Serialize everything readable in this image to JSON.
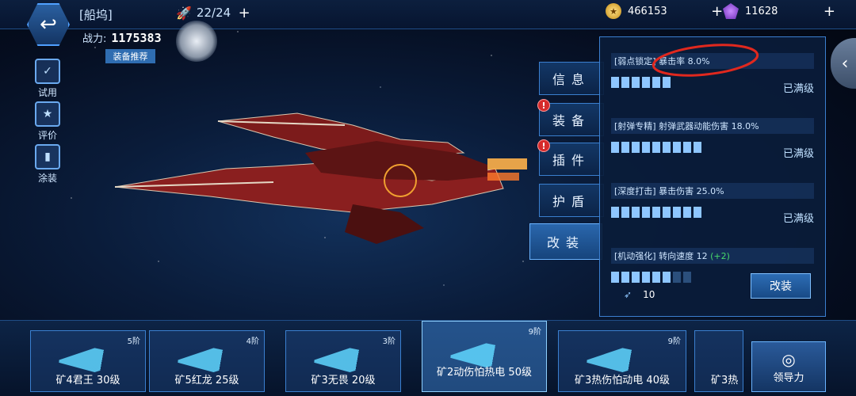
{
  "top": {
    "title": "[船坞]",
    "dock_count": "22/24",
    "power_label": "战力:",
    "power_value": "1175383",
    "recommend_btn": "装备推荐",
    "coins": "466153",
    "gems": "11628",
    "plus": "+"
  },
  "sidebar": [
    {
      "label": "试用",
      "icon": "✓"
    },
    {
      "label": "评价",
      "icon": "★"
    },
    {
      "label": "涂装",
      "icon": "▮"
    }
  ],
  "tabs": [
    {
      "label": "信息",
      "alert": false,
      "active": false
    },
    {
      "label": "装备",
      "alert": true,
      "active": false
    },
    {
      "label": "插件",
      "alert": true,
      "active": false
    },
    {
      "label": "护盾",
      "alert": false,
      "active": false
    },
    {
      "label": "改装",
      "alert": false,
      "active": true
    }
  ],
  "mods": [
    {
      "head": "[弱点锁定] 暴击率 8.0%",
      "filled": 6,
      "total": 6,
      "status": "已满级"
    },
    {
      "head": "[射弹专精] 射弹武器动能伤害 18.0%",
      "filled": 9,
      "total": 9,
      "status": "已满级"
    },
    {
      "head": "[深度打击] 暴击伤害 25.0%",
      "filled": 9,
      "total": 9,
      "status": "已满级"
    },
    {
      "head": "[机动强化] 转向速度 12",
      "bonus": "(+2)",
      "filled": 6,
      "total": 8,
      "status": ""
    }
  ],
  "modify_btn": "改装",
  "material_count": "10",
  "ships": [
    {
      "name": "矿4君王 30级",
      "tier": "5阶"
    },
    {
      "name": "矿5红龙 25级",
      "tier": "4阶"
    },
    {
      "name": "矿3无畏 20级",
      "tier": "3阶"
    },
    {
      "name": "矿2动伤怕热电 50级",
      "tier": "9阶",
      "selected": true
    },
    {
      "name": "矿3热伤怕动电 40级",
      "tier": "9阶"
    },
    {
      "name": "矿3热",
      "tier": ""
    }
  ],
  "guide_btn": "领导力",
  "colors": {
    "accent": "#3a7fcf",
    "active": "#6ab3ff",
    "alert": "#d62b2b",
    "bonus": "#47d96b"
  }
}
